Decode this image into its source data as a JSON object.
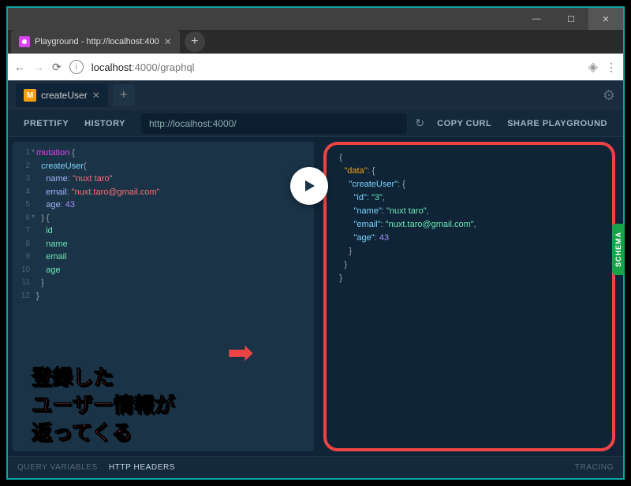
{
  "window": {
    "minimize": "—",
    "maximize": "☐",
    "close": "✕"
  },
  "browser": {
    "tab_title": "Playground - http://localhost:400",
    "url_host": "localhost",
    "url_port": ":4000",
    "url_path": "/graphql",
    "plus": "+",
    "close_x": "✕",
    "back": "←",
    "forward": "→",
    "reload": "⟳",
    "info": "i",
    "menu_dots": "⋮"
  },
  "app": {
    "tab_icon_letter": "M",
    "tab_name": "createUser",
    "tab_x": "✕",
    "plus": "+",
    "gear": "⚙",
    "prettify": "PRETTIFY",
    "history": "HISTORY",
    "endpoint": "http://localhost:4000/",
    "reload": "↻",
    "copy_curl": "COPY CURL",
    "share": "SHARE PLAYGROUND",
    "schema": "SCHEMA",
    "footer_qv": "QUERY VARIABLES",
    "footer_hh": "HTTP HEADERS",
    "tracing": "TRACING"
  },
  "editor": {
    "mutation": "mutation",
    "createUser": "createUser",
    "name_arg": "name",
    "name_val": "\"nuxt taro\"",
    "email_arg": "email",
    "email_val": "\"nuxt.taro@gmail.com\"",
    "age_arg": "age",
    "age_val": "43",
    "f_id": "id",
    "f_name": "name",
    "f_email": "email",
    "f_age": "age"
  },
  "result": {
    "data": "\"data\"",
    "createUser": "\"createUser\"",
    "id_k": "\"id\"",
    "id_v": "\"3\"",
    "name_k": "\"name\"",
    "name_v": "\"nuxt taro\"",
    "email_k": "\"email\"",
    "email_v": "\"nuxt.taro@gmail.com\"",
    "age_k": "\"age\"",
    "age_v": "43"
  },
  "annotation": {
    "line1": "登録した",
    "line2": "ユーザー情報が",
    "line3": "返ってくる",
    "arrow": "➡"
  },
  "gutter": [
    "1",
    "2",
    "3",
    "4",
    "5",
    "6",
    "7",
    "8",
    "9",
    "10",
    "11",
    "12"
  ]
}
